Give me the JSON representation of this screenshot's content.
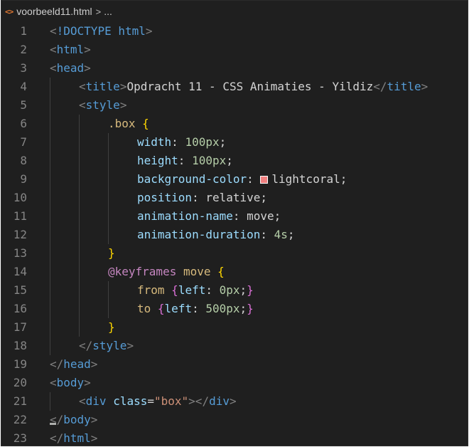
{
  "breadcrumb": {
    "file_icon": "<>",
    "filename": "voorbeeld11.html",
    "separator": ">",
    "more": "..."
  },
  "editor": {
    "swatch_color": "#f08080",
    "lines": [
      {
        "n": "1",
        "indent": 0,
        "tokens": [
          [
            "t-punc",
            "<"
          ],
          [
            "t-doc",
            "!DOCTYPE"
          ],
          [
            "t-text",
            " "
          ],
          [
            "t-tag",
            "html"
          ],
          [
            "t-punc",
            ">"
          ]
        ]
      },
      {
        "n": "2",
        "indent": 0,
        "tokens": [
          [
            "t-punc",
            "<"
          ],
          [
            "t-tag",
            "html"
          ],
          [
            "t-punc",
            ">"
          ]
        ]
      },
      {
        "n": "3",
        "indent": 0,
        "tokens": [
          [
            "t-punc",
            "<"
          ],
          [
            "t-tag",
            "head"
          ],
          [
            "t-punc",
            ">"
          ]
        ]
      },
      {
        "n": "4",
        "indent": 1,
        "tokens": [
          [
            "t-punc",
            "<"
          ],
          [
            "t-tag",
            "title"
          ],
          [
            "t-punc",
            ">"
          ],
          [
            "t-text",
            "Opdracht 11 - CSS Animaties - Yildiz"
          ],
          [
            "t-punc",
            "</"
          ],
          [
            "t-tag",
            "title"
          ],
          [
            "t-punc",
            ">"
          ]
        ]
      },
      {
        "n": "5",
        "indent": 1,
        "tokens": [
          [
            "t-punc",
            "<"
          ],
          [
            "t-tag",
            "style"
          ],
          [
            "t-punc",
            ">"
          ]
        ]
      },
      {
        "n": "6",
        "indent": 2,
        "tokens": [
          [
            "t-sel",
            ".box"
          ],
          [
            "t-text",
            " "
          ],
          [
            "t-brace",
            "{"
          ]
        ]
      },
      {
        "n": "7",
        "indent": 3,
        "tokens": [
          [
            "t-prop",
            "width"
          ],
          [
            "t-val",
            ": "
          ],
          [
            "t-num",
            "100px"
          ],
          [
            "t-val",
            ";"
          ]
        ]
      },
      {
        "n": "8",
        "indent": 3,
        "tokens": [
          [
            "t-prop",
            "height"
          ],
          [
            "t-val",
            ": "
          ],
          [
            "t-num",
            "100px"
          ],
          [
            "t-val",
            ";"
          ]
        ]
      },
      {
        "n": "9",
        "indent": 3,
        "tokens": [
          [
            "t-prop",
            "background-color"
          ],
          [
            "t-val",
            ": "
          ],
          [
            "swatch",
            ""
          ],
          [
            "t-val",
            "lightcoral;"
          ]
        ]
      },
      {
        "n": "10",
        "indent": 3,
        "tokens": [
          [
            "t-prop",
            "position"
          ],
          [
            "t-val",
            ": relative;"
          ]
        ]
      },
      {
        "n": "11",
        "indent": 3,
        "tokens": [
          [
            "t-prop",
            "animation-name"
          ],
          [
            "t-val",
            ": move;"
          ]
        ]
      },
      {
        "n": "12",
        "indent": 3,
        "tokens": [
          [
            "t-prop",
            "animation-duration"
          ],
          [
            "t-val",
            ": "
          ],
          [
            "t-num",
            "4s"
          ],
          [
            "t-val",
            ";"
          ]
        ]
      },
      {
        "n": "13",
        "indent": 2,
        "tokens": [
          [
            "t-brace",
            "}"
          ]
        ]
      },
      {
        "n": "14",
        "indent": 2,
        "tokens": [
          [
            "t-at",
            "@keyframes"
          ],
          [
            "t-text",
            " "
          ],
          [
            "t-sel",
            "move"
          ],
          [
            "t-text",
            " "
          ],
          [
            "t-brace",
            "{"
          ]
        ]
      },
      {
        "n": "15",
        "indent": 3,
        "tokens": [
          [
            "t-sel",
            "from"
          ],
          [
            "t-text",
            " "
          ],
          [
            "t-brace2",
            "{"
          ],
          [
            "t-prop",
            "left"
          ],
          [
            "t-val",
            ": "
          ],
          [
            "t-num",
            "0px"
          ],
          [
            "t-val",
            ";"
          ],
          [
            "t-brace2",
            "}"
          ]
        ]
      },
      {
        "n": "16",
        "indent": 3,
        "tokens": [
          [
            "t-sel",
            "to"
          ],
          [
            "t-text",
            " "
          ],
          [
            "t-brace2",
            "{"
          ],
          [
            "t-prop",
            "left"
          ],
          [
            "t-val",
            ": "
          ],
          [
            "t-num",
            "500px"
          ],
          [
            "t-val",
            ";"
          ],
          [
            "t-brace2",
            "}"
          ]
        ]
      },
      {
        "n": "17",
        "indent": 2,
        "tokens": [
          [
            "t-brace",
            "}"
          ]
        ]
      },
      {
        "n": "18",
        "indent": 1,
        "tokens": [
          [
            "t-punc",
            "</"
          ],
          [
            "t-tag",
            "style"
          ],
          [
            "t-punc",
            ">"
          ]
        ]
      },
      {
        "n": "19",
        "indent": 0,
        "tokens": [
          [
            "t-punc",
            "</"
          ],
          [
            "t-tag",
            "head"
          ],
          [
            "t-punc",
            ">"
          ]
        ]
      },
      {
        "n": "20",
        "indent": 0,
        "tokens": [
          [
            "t-punc",
            "<"
          ],
          [
            "t-tag",
            "body"
          ],
          [
            "t-punc",
            ">"
          ]
        ]
      },
      {
        "n": "21",
        "indent": 1,
        "tokens": [
          [
            "t-punc",
            "<"
          ],
          [
            "t-tag",
            "div"
          ],
          [
            "t-text",
            " "
          ],
          [
            "t-attr",
            "class"
          ],
          [
            "t-text",
            "="
          ],
          [
            "t-str",
            "\"box\""
          ],
          [
            "t-punc",
            "></"
          ],
          [
            "t-tag",
            "div"
          ],
          [
            "t-punc",
            ">"
          ]
        ]
      },
      {
        "n": "22",
        "indent": 0,
        "tokens": [
          [
            "t-punc",
            "</"
          ],
          [
            "t-tag",
            "body"
          ],
          [
            "t-punc",
            ">"
          ]
        ]
      },
      {
        "n": "23",
        "indent": 0,
        "tokens": [
          [
            "t-punc",
            "</"
          ],
          [
            "t-tag",
            "html"
          ],
          [
            "t-punc",
            ">"
          ]
        ]
      }
    ]
  }
}
